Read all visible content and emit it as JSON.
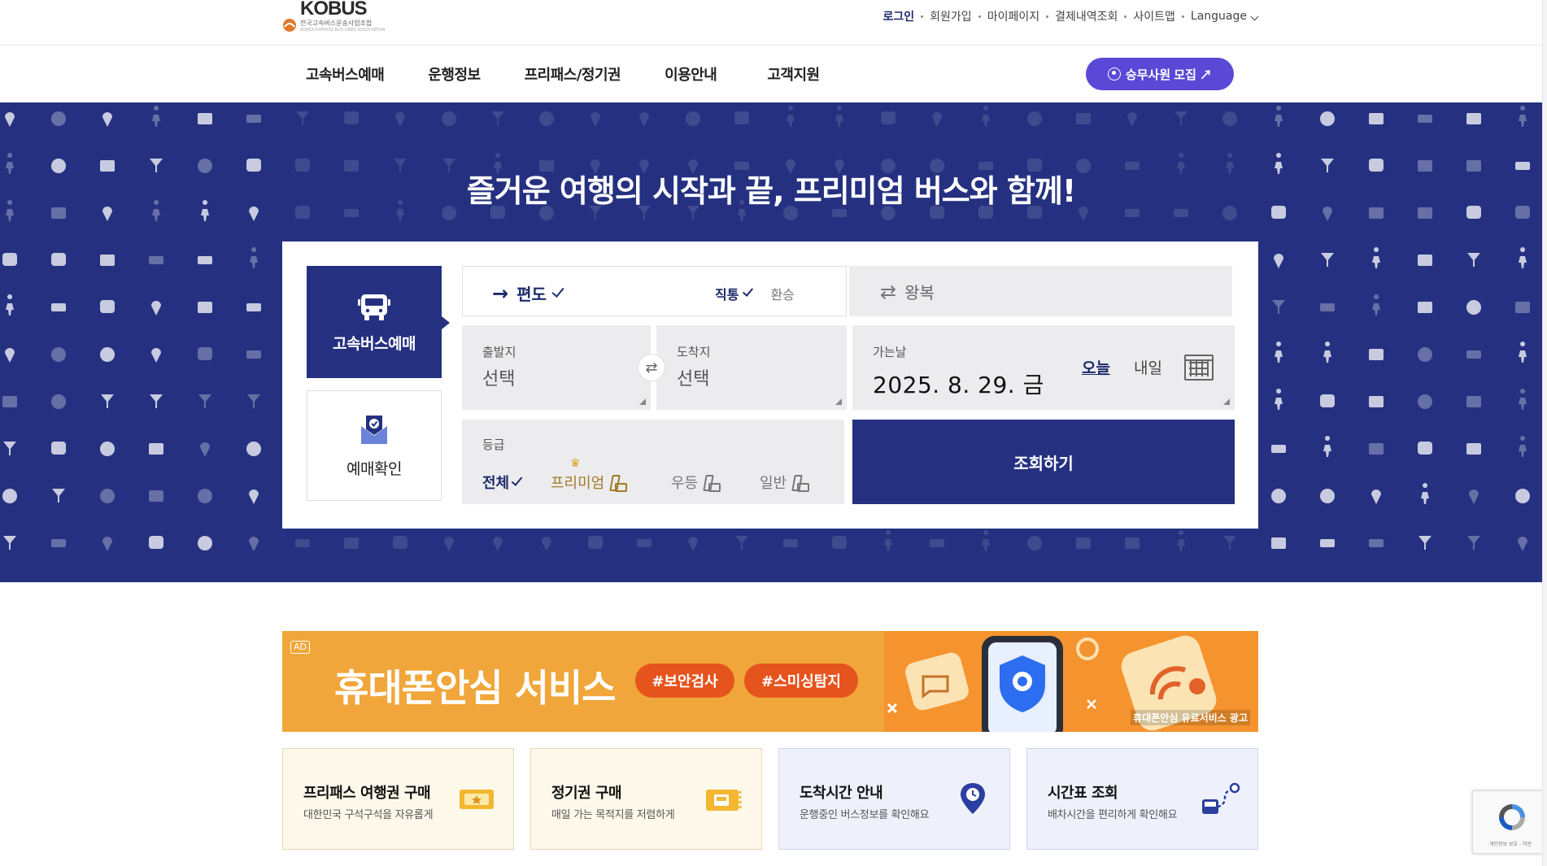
{
  "brand": {
    "logo_text": "KOBUS",
    "logo_sub": "전국고속버스운송사업조합",
    "logo_sub_en": "KOREA EXPRESS BUS LINES ASSOCIATION"
  },
  "utility_nav": {
    "login": "로그인",
    "signup": "회원가입",
    "mypage": "마이페이지",
    "payments": "결제내역조회",
    "sitemap": "사이트맵",
    "language": "Language"
  },
  "main_nav": [
    "고속버스예매",
    "운행정보",
    "프리패스/정기권",
    "이용안내",
    "고객지원"
  ],
  "recruit_button": "승무사원 모집 ↗",
  "hero": {
    "title": "즐거운 여행의 시작과 끝, 프리미엄 버스와 함께!"
  },
  "side_tabs": {
    "reserve": "고속버스예매",
    "check": "예매확인"
  },
  "trip": {
    "oneway": "편도",
    "direct": "직통",
    "transfer": "환승",
    "roundtrip": "왕복"
  },
  "departure": {
    "label": "출발지",
    "value": "선택"
  },
  "arrival": {
    "label": "도착지",
    "value": "선택"
  },
  "date": {
    "label": "가는날",
    "value": "2025. 8. 29. 금",
    "today": "오늘",
    "tomorrow": "내일"
  },
  "grade": {
    "label": "등급",
    "options": [
      "전체",
      "프리미엄",
      "우등",
      "일반"
    ],
    "selected": "전체"
  },
  "search_button": "조회하기",
  "ad": {
    "tag": "AD",
    "title": "휴대폰안심 서비스",
    "tags": [
      "#보안검사",
      "#스미싱탐지"
    ],
    "caption": "휴대폰안심 유료서비스 광고"
  },
  "quick_links": [
    {
      "title": "프리패스 여행권 구매",
      "subtitle": "대한민국 구석구석을 자유롭게",
      "icon": "ticket-icon"
    },
    {
      "title": "정기권 구매",
      "subtitle": "매일 가는 목적지를 저렴하게",
      "icon": "pass-icon"
    },
    {
      "title": "도착시간 안내",
      "subtitle": "운행중인 버스정보를 확인해요",
      "icon": "location-pin-icon"
    },
    {
      "title": "시간표 조회",
      "subtitle": "배차시간을 편리하게 확인해요",
      "icon": "route-bus-icon"
    }
  ],
  "recaptcha_text": "개인정보 보호 - 약관",
  "colors": {
    "navy": "#253180",
    "purple": "#5b48d6",
    "ad_orange": "#f0a63a",
    "pill_red": "#e6541d"
  }
}
